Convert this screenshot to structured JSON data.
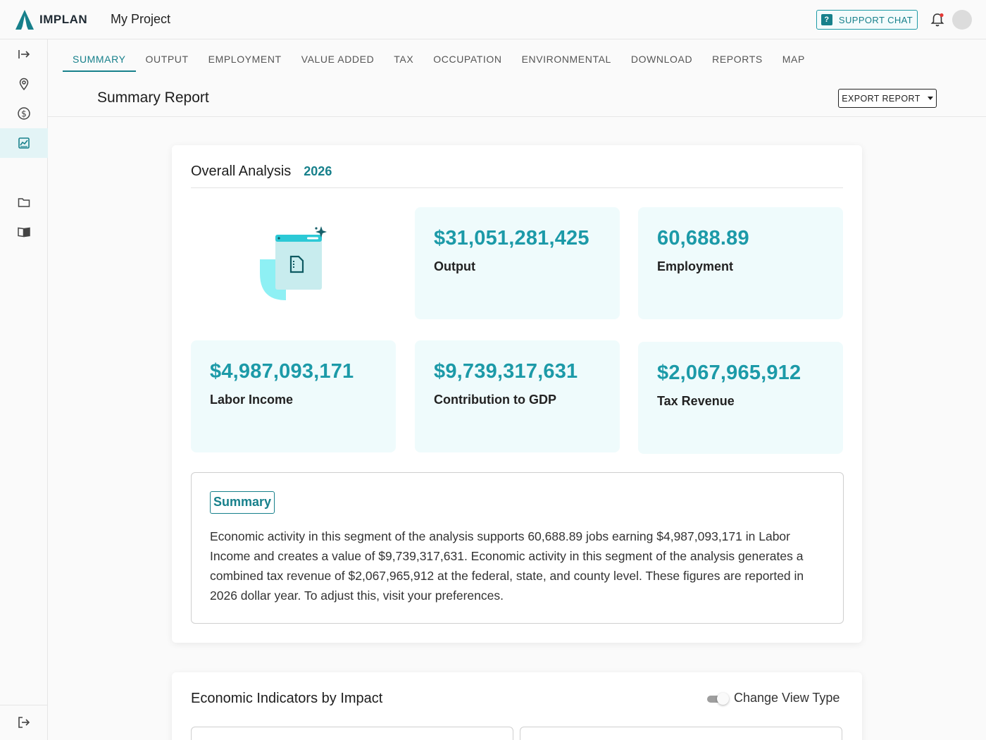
{
  "brand": {
    "name": "IMPLAN"
  },
  "header": {
    "project_title": "My Project",
    "support_label": "SUPPORT CHAT",
    "support_icon": "?"
  },
  "tabs": [
    {
      "label": "SUMMARY",
      "active": true
    },
    {
      "label": "OUTPUT"
    },
    {
      "label": "EMPLOYMENT"
    },
    {
      "label": "VALUE ADDED"
    },
    {
      "label": "TAX"
    },
    {
      "label": "OCCUPATION"
    },
    {
      "label": "ENVIRONMENTAL"
    },
    {
      "label": "DOWNLOAD"
    },
    {
      "label": "REPORTS"
    },
    {
      "label": "MAP"
    }
  ],
  "page": {
    "title": "Summary Report",
    "export_label": "EXPORT REPORT"
  },
  "overall": {
    "title": "Overall Analysis",
    "year": "2026",
    "stats": [
      {
        "value": "$31,051,281,425",
        "label": "Output"
      },
      {
        "value": "60,688.89",
        "label": "Employment"
      },
      {
        "value": "$4,987,093,171",
        "label": "Labor Income"
      },
      {
        "value": "$9,739,317,631",
        "label": "Contribution to GDP"
      },
      {
        "value": "$2,067,965,912",
        "label": "Tax Revenue"
      }
    ],
    "summary_tag": "Summary",
    "summary_text": "Economic activity in this segment of the analysis supports 60,688.89 jobs earning $4,987,093,171 in Labor Income and creates a value of $9,739,317,631. Economic activity in this segment of the analysis generates a combined tax revenue of $2,067,965,912 at the federal, state, and county level. These figures are reported in 2026 dollar year. To adjust this, visit your preferences."
  },
  "indicators": {
    "title": "Economic Indicators by Impact",
    "toggle_label": "Change View Type"
  },
  "colors": {
    "accent": "#17808b",
    "stat_value": "#1c9aa8",
    "stat_bg": "#effbfc"
  }
}
